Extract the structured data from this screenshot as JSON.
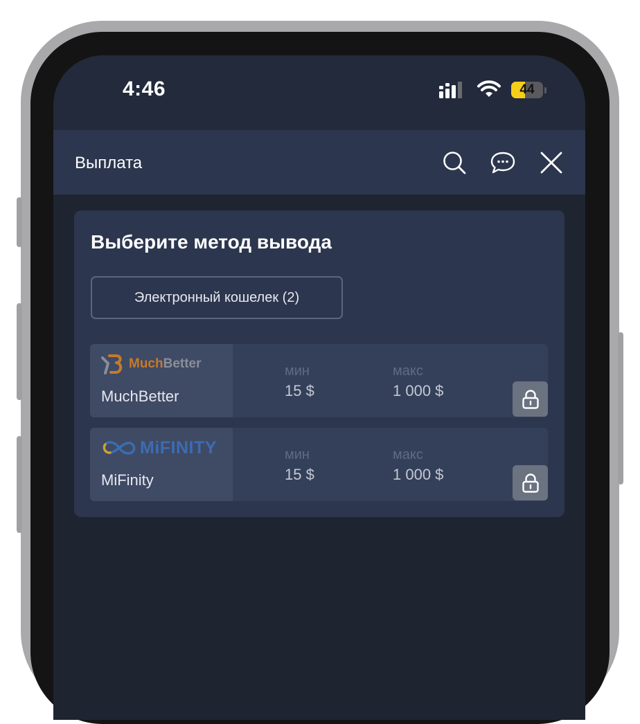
{
  "status_bar": {
    "time": "4:46",
    "battery_level": "44"
  },
  "header": {
    "title": "Выплата"
  },
  "card": {
    "title": "Выберите метод вывода",
    "filter_chip": "Электронный кошелек (2)"
  },
  "methods": [
    {
      "logo_part1": "Much",
      "logo_part2": "Better",
      "name": "MuchBetter",
      "min_label": "мин",
      "min_value": "15 $",
      "max_label": "макс",
      "max_value": "1 000 $"
    },
    {
      "logo_text": "MiFINITY",
      "name": "MiFinity",
      "min_label": "мин",
      "min_value": "15 $",
      "max_label": "макс",
      "max_value": "1 000 $"
    }
  ],
  "icons": {
    "signal": "signal-icon",
    "wifi": "wifi-icon",
    "battery": "battery-icon",
    "search": "search-icon",
    "chat": "chat-icon",
    "close": "close-icon",
    "lock": "lock-icon"
  },
  "colors": {
    "screen_bg": "#1f2431",
    "header_bg": "#2c364e",
    "card_bg": "#2c364e",
    "row_bg": "#34405a",
    "battery_yellow": "#f5cf1a",
    "much_orange": "#c67a2a",
    "mifinity_blue": "#3c6cb2"
  }
}
